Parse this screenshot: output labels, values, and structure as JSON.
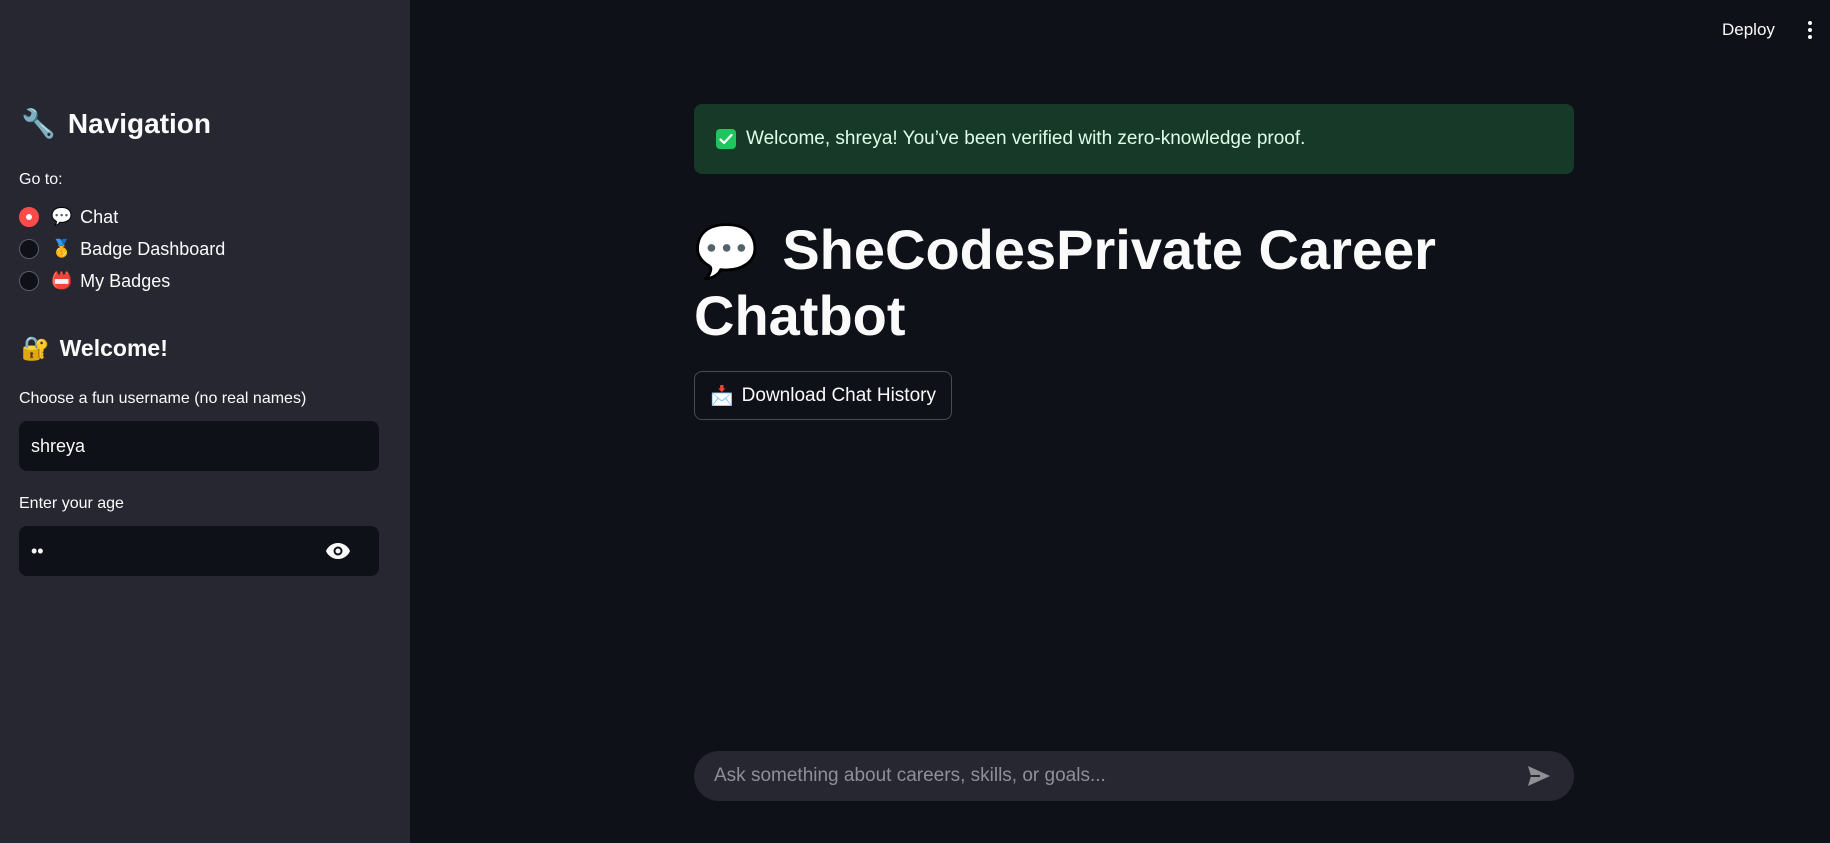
{
  "header": {
    "deploy_label": "Deploy",
    "menu_icon": "kebab-menu-icon"
  },
  "sidebar": {
    "nav_heading_emoji": "🔧",
    "nav_heading": "Navigation",
    "goto_label": "Go to:",
    "nav_items": [
      {
        "emoji": "💬",
        "label": "Chat",
        "selected": true
      },
      {
        "emoji": "🥇",
        "label": "Badge Dashboard",
        "selected": false
      },
      {
        "emoji": "📛",
        "label": "My Badges",
        "selected": false
      }
    ],
    "welcome_emoji": "🔐",
    "welcome_heading": "Welcome!",
    "username_label": "Choose a fun username (no real names)",
    "username_value": "shreya",
    "age_label": "Enter your age",
    "age_value": "••",
    "age_icon": "eye-icon"
  },
  "main": {
    "alert_text": "Welcome, shreya! You’ve been verified with zero-knowledge proof.",
    "alert_icon": "check-icon",
    "title_emoji": "💬",
    "title": "SheCodesPrivate Career Chatbot",
    "download_emoji": "📩",
    "download_label": "Download Chat History",
    "chat_placeholder": "Ask something about careers, skills, or goals...",
    "send_icon": "send-icon"
  },
  "colors": {
    "background": "#0e1117",
    "sidebar": "#262730",
    "accent": "#ff4b4b",
    "success_bg": "#173928",
    "success_check": "#21c55d"
  }
}
